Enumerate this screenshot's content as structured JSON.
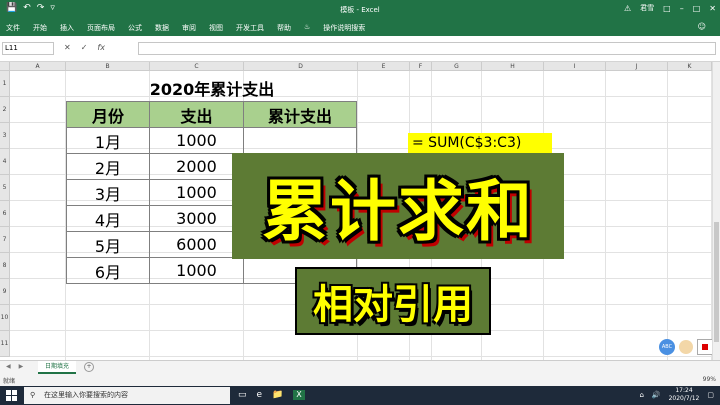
{
  "window": {
    "title": "模板 - Excel",
    "user_label": "君雪",
    "warning_icon": "warning-icon"
  },
  "menu": {
    "items": [
      "文件",
      "开始",
      "插入",
      "页面布局",
      "公式",
      "数据",
      "审阅",
      "视图",
      "开发工具",
      "帮助"
    ],
    "search_label": "操作说明搜索"
  },
  "formula_bar": {
    "name_box": "L11",
    "formula": ""
  },
  "columns": [
    "A",
    "B",
    "C",
    "D",
    "E",
    "F",
    "G",
    "H",
    "I",
    "J",
    "K"
  ],
  "rows": [
    "1",
    "2",
    "3",
    "4",
    "5",
    "6",
    "7",
    "8",
    "9",
    "10",
    "11"
  ],
  "sheet": {
    "title": "2020年累计支出",
    "headers": [
      "月份",
      "支出",
      "累计支出"
    ],
    "data": [
      [
        "1月",
        "1000",
        ""
      ],
      [
        "2月",
        "2000",
        ""
      ],
      [
        "3月",
        "1000",
        ""
      ],
      [
        "4月",
        "3000",
        ""
      ],
      [
        "5月",
        "6000",
        ""
      ],
      [
        "6月",
        "1000",
        ""
      ]
    ],
    "formula_note": "=  SUM(C$3:C3)"
  },
  "overlay": {
    "main_text": "累计求和",
    "sub_text": "相对引用"
  },
  "tabs": {
    "active": "日期填充"
  },
  "status": {
    "left": "就绪",
    "zoom": "99%"
  },
  "taskbar": {
    "search_placeholder": "在这里输入你要搜索的内容",
    "time": "17:24",
    "date": "2020/7/12"
  },
  "colors": {
    "excel_green": "#217346",
    "header_fill": "#a9d08e",
    "banner_fill": "#5d7b34",
    "banner_text": "#ffff00"
  }
}
